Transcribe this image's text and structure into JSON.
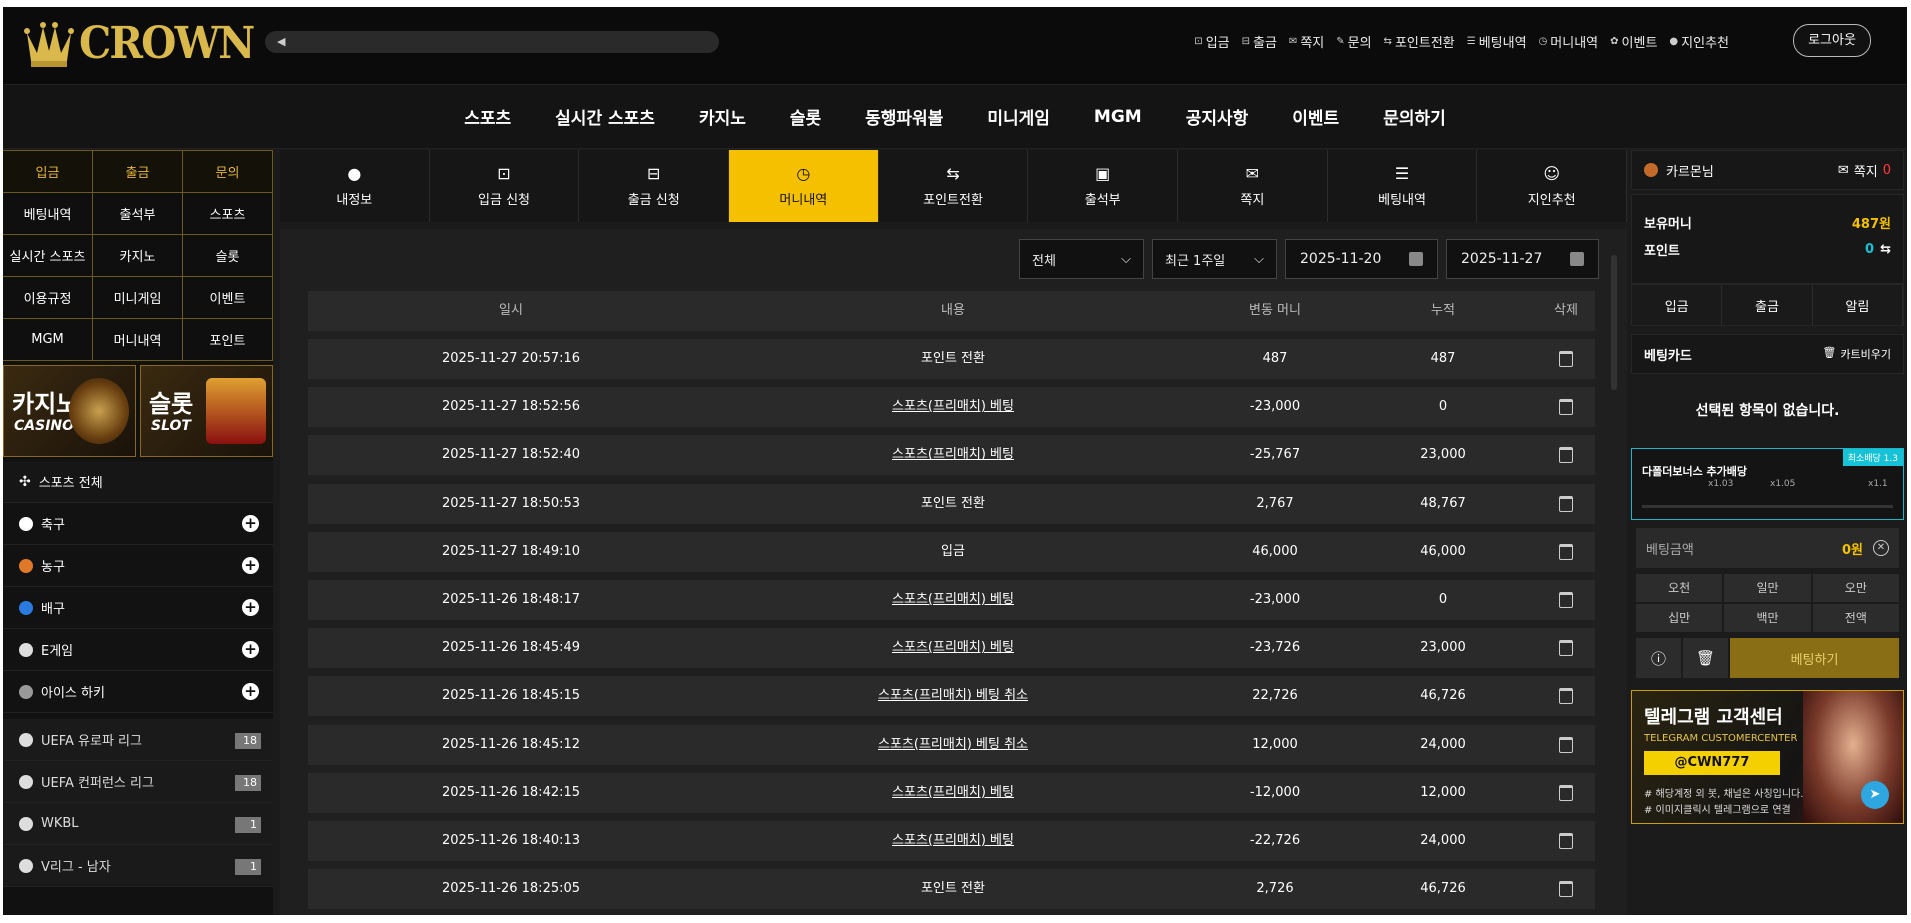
{
  "header": {
    "logo": "CROWN",
    "ticker_icon": "megaphone-icon",
    "logout": "로그아웃",
    "links": [
      {
        "icon": "deposit-icon",
        "label": "입금"
      },
      {
        "icon": "withdraw-icon",
        "label": "출금"
      },
      {
        "icon": "mail-icon",
        "label": "쪽지"
      },
      {
        "icon": "inquiry-icon",
        "label": "문의"
      },
      {
        "icon": "exchange-icon",
        "label": "포인트전환"
      },
      {
        "icon": "list-icon",
        "label": "베팅내역"
      },
      {
        "icon": "clock-icon",
        "label": "머니내역"
      },
      {
        "icon": "gift-icon",
        "label": "이벤트"
      },
      {
        "icon": "user-icon",
        "label": "지인추천"
      }
    ]
  },
  "mainnav": [
    "스포츠",
    "실시간 스포츠",
    "카지노",
    "슬롯",
    "동행파워볼",
    "미니게임",
    "MGM",
    "공지사항",
    "이벤트",
    "문의하기"
  ],
  "left": {
    "quick": [
      {
        "label": "입금",
        "gold": true
      },
      {
        "label": "출금",
        "gold": true
      },
      {
        "label": "문의",
        "gold": true
      },
      {
        "label": "베팅내역"
      },
      {
        "label": "출석부"
      },
      {
        "label": "스포츠"
      },
      {
        "label": "실시간 스포츠"
      },
      {
        "label": "카지노"
      },
      {
        "label": "슬롯"
      },
      {
        "label": "이용규정"
      },
      {
        "label": "미니게임"
      },
      {
        "label": "이벤트"
      },
      {
        "label": "MGM"
      },
      {
        "label": "머니내역"
      },
      {
        "label": "포인트"
      }
    ],
    "banners": [
      {
        "big": "카지노",
        "small": "CASINO"
      },
      {
        "big": "슬롯",
        "small": "SLOT"
      }
    ],
    "sport_all": "스포츠 전체",
    "sports": [
      "축구",
      "농구",
      "배구",
      "E게임",
      "아이스 하키"
    ],
    "leagues": [
      {
        "name": "UEFA 유로파 리그",
        "count": "18"
      },
      {
        "name": "UEFA 컨퍼런스 리그",
        "count": "18"
      },
      {
        "name": "WKBL",
        "count": "1"
      },
      {
        "name": "V리그 - 남자",
        "count": "1"
      }
    ]
  },
  "tabs": [
    {
      "icon": "user-icon",
      "label": "내정보"
    },
    {
      "icon": "deposit-icon",
      "label": "입금 신청"
    },
    {
      "icon": "withdraw-icon",
      "label": "출금 신청"
    },
    {
      "icon": "clock-icon",
      "label": "머니내역",
      "active": true
    },
    {
      "icon": "exchange-icon",
      "label": "포인트전환"
    },
    {
      "icon": "calendar-icon",
      "label": "출석부"
    },
    {
      "icon": "mail-icon",
      "label": "쪽지"
    },
    {
      "icon": "list-icon",
      "label": "베팅내역"
    },
    {
      "icon": "user-plus-icon",
      "label": "지인추천"
    }
  ],
  "filters": {
    "type": "전체",
    "period": "최근 1주일",
    "from": "2025-11-20",
    "to": "2025-11-27"
  },
  "table": {
    "headers": [
      "일시",
      "내용",
      "변동 머니",
      "누적",
      "삭제"
    ],
    "rows": [
      {
        "date": "2025-11-27 20:57:16",
        "content": "포인트 전환",
        "change": "487",
        "total": "487"
      },
      {
        "date": "2025-11-27 18:52:56",
        "content": "스포츠(프리매치) 베팅",
        "change": "-23,000",
        "total": "0"
      },
      {
        "date": "2025-11-27 18:52:40",
        "content": "스포츠(프리매치) 베팅",
        "change": "-25,767",
        "total": "23,000"
      },
      {
        "date": "2025-11-27 18:50:53",
        "content": "포인트 전환",
        "change": "2,767",
        "total": "48,767"
      },
      {
        "date": "2025-11-27 18:49:10",
        "content": "입금",
        "change": "46,000",
        "total": "46,000"
      },
      {
        "date": "2025-11-26 18:48:17",
        "content": "스포츠(프리매치) 베팅",
        "change": "-23,000",
        "total": "0"
      },
      {
        "date": "2025-11-26 18:45:49",
        "content": "스포츠(프리매치) 베팅",
        "change": "-23,726",
        "total": "23,000"
      },
      {
        "date": "2025-11-26 18:45:15",
        "content": "스포츠(프리매치) 베팅 취소",
        "change": "22,726",
        "total": "46,726"
      },
      {
        "date": "2025-11-26 18:45:12",
        "content": "스포츠(프리매치) 베팅 취소",
        "change": "12,000",
        "total": "24,000"
      },
      {
        "date": "2025-11-26 18:42:15",
        "content": "스포츠(프리매치) 베팅",
        "change": "-12,000",
        "total": "12,000"
      },
      {
        "date": "2025-11-26 18:40:13",
        "content": "스포츠(프리매치) 베팅",
        "change": "-22,726",
        "total": "24,000"
      },
      {
        "date": "2025-11-26 18:25:05",
        "content": "포인트 전환",
        "change": "2,726",
        "total": "46,726"
      }
    ]
  },
  "right": {
    "username": "카르몬님",
    "msg_label": "쪽지",
    "msg_count": "0",
    "money_label": "보유머니",
    "money": "487원",
    "point_label": "포인트",
    "point": "0",
    "actions": [
      "입금",
      "출금",
      "알림"
    ],
    "betcard": "베팅카드",
    "clear": "카트비우기",
    "empty": "선택된 항목이 없습니다.",
    "bonus": {
      "badge": "최소배당 1.3",
      "title": "다폴더보너스 추가배당",
      "marks": [
        "x1.03",
        "x1.05",
        "x1.1"
      ]
    },
    "amount_label": "베팅금액",
    "amount": "0원",
    "chips": [
      "오천",
      "일만",
      "오만",
      "십만",
      "백만",
      "전액"
    ],
    "bet_button": "베팅하기",
    "telegram": {
      "title": "텔레그램 고객센터",
      "en": "TELEGRAM CUSTOMERCENTER",
      "id": "@CWN777",
      "note1": "# 해당계정 외 봇, 채널은 사칭입니다.",
      "note2": "# 이미지클릭시 텔레그램으로 연결"
    }
  },
  "colors": {
    "gold": "#f5c000",
    "dark": "#1b1b1b",
    "accent": "#17c1d6"
  }
}
